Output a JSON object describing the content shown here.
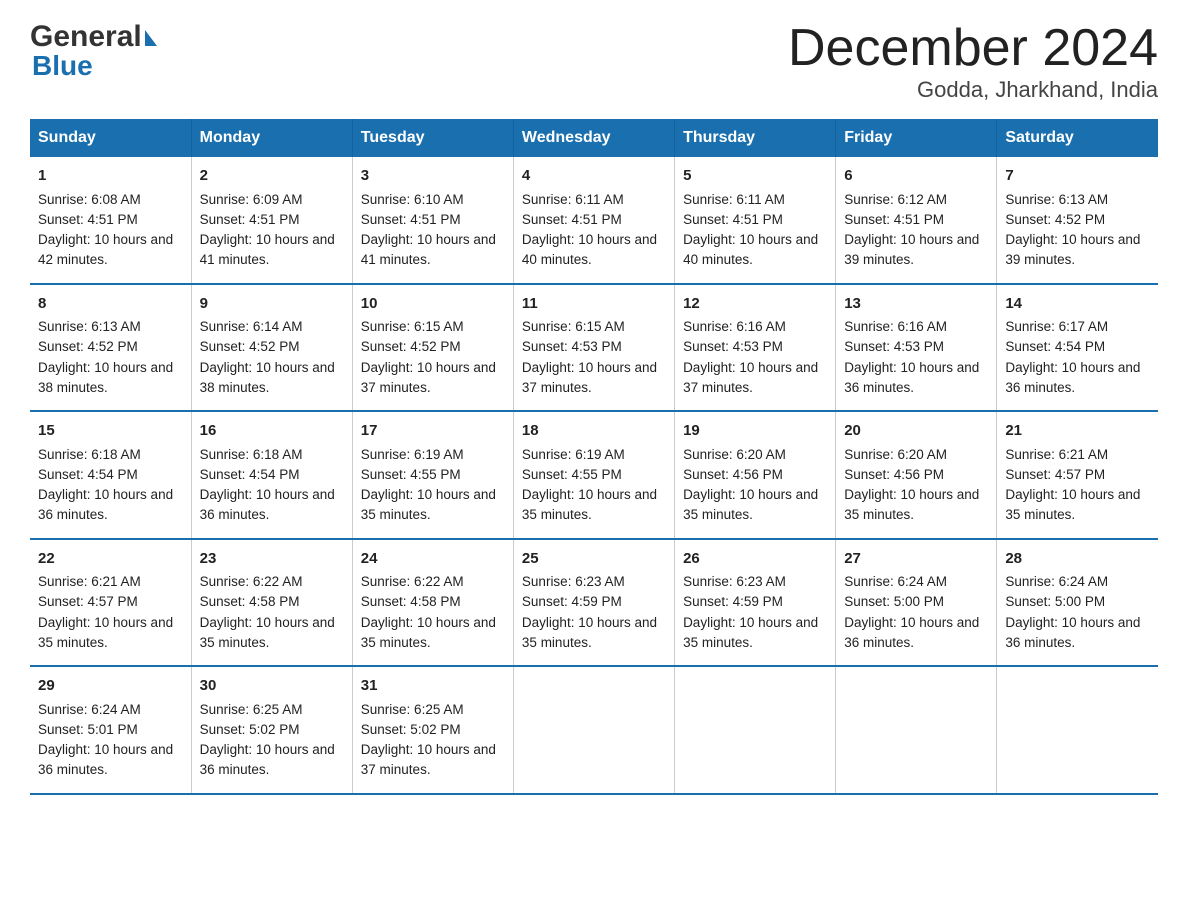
{
  "header": {
    "title": "December 2024",
    "subtitle": "Godda, Jharkhand, India",
    "logo_general": "General",
    "logo_blue": "Blue"
  },
  "days_of_week": [
    "Sunday",
    "Monday",
    "Tuesday",
    "Wednesday",
    "Thursday",
    "Friday",
    "Saturday"
  ],
  "weeks": [
    {
      "days": [
        {
          "num": "1",
          "sunrise": "6:08 AM",
          "sunset": "4:51 PM",
          "daylight": "10 hours and 42 minutes."
        },
        {
          "num": "2",
          "sunrise": "6:09 AM",
          "sunset": "4:51 PM",
          "daylight": "10 hours and 41 minutes."
        },
        {
          "num": "3",
          "sunrise": "6:10 AM",
          "sunset": "4:51 PM",
          "daylight": "10 hours and 41 minutes."
        },
        {
          "num": "4",
          "sunrise": "6:11 AM",
          "sunset": "4:51 PM",
          "daylight": "10 hours and 40 minutes."
        },
        {
          "num": "5",
          "sunrise": "6:11 AM",
          "sunset": "4:51 PM",
          "daylight": "10 hours and 40 minutes."
        },
        {
          "num": "6",
          "sunrise": "6:12 AM",
          "sunset": "4:51 PM",
          "daylight": "10 hours and 39 minutes."
        },
        {
          "num": "7",
          "sunrise": "6:13 AM",
          "sunset": "4:52 PM",
          "daylight": "10 hours and 39 minutes."
        }
      ]
    },
    {
      "days": [
        {
          "num": "8",
          "sunrise": "6:13 AM",
          "sunset": "4:52 PM",
          "daylight": "10 hours and 38 minutes."
        },
        {
          "num": "9",
          "sunrise": "6:14 AM",
          "sunset": "4:52 PM",
          "daylight": "10 hours and 38 minutes."
        },
        {
          "num": "10",
          "sunrise": "6:15 AM",
          "sunset": "4:52 PM",
          "daylight": "10 hours and 37 minutes."
        },
        {
          "num": "11",
          "sunrise": "6:15 AM",
          "sunset": "4:53 PM",
          "daylight": "10 hours and 37 minutes."
        },
        {
          "num": "12",
          "sunrise": "6:16 AM",
          "sunset": "4:53 PM",
          "daylight": "10 hours and 37 minutes."
        },
        {
          "num": "13",
          "sunrise": "6:16 AM",
          "sunset": "4:53 PM",
          "daylight": "10 hours and 36 minutes."
        },
        {
          "num": "14",
          "sunrise": "6:17 AM",
          "sunset": "4:54 PM",
          "daylight": "10 hours and 36 minutes."
        }
      ]
    },
    {
      "days": [
        {
          "num": "15",
          "sunrise": "6:18 AM",
          "sunset": "4:54 PM",
          "daylight": "10 hours and 36 minutes."
        },
        {
          "num": "16",
          "sunrise": "6:18 AM",
          "sunset": "4:54 PM",
          "daylight": "10 hours and 36 minutes."
        },
        {
          "num": "17",
          "sunrise": "6:19 AM",
          "sunset": "4:55 PM",
          "daylight": "10 hours and 35 minutes."
        },
        {
          "num": "18",
          "sunrise": "6:19 AM",
          "sunset": "4:55 PM",
          "daylight": "10 hours and 35 minutes."
        },
        {
          "num": "19",
          "sunrise": "6:20 AM",
          "sunset": "4:56 PM",
          "daylight": "10 hours and 35 minutes."
        },
        {
          "num": "20",
          "sunrise": "6:20 AM",
          "sunset": "4:56 PM",
          "daylight": "10 hours and 35 minutes."
        },
        {
          "num": "21",
          "sunrise": "6:21 AM",
          "sunset": "4:57 PM",
          "daylight": "10 hours and 35 minutes."
        }
      ]
    },
    {
      "days": [
        {
          "num": "22",
          "sunrise": "6:21 AM",
          "sunset": "4:57 PM",
          "daylight": "10 hours and 35 minutes."
        },
        {
          "num": "23",
          "sunrise": "6:22 AM",
          "sunset": "4:58 PM",
          "daylight": "10 hours and 35 minutes."
        },
        {
          "num": "24",
          "sunrise": "6:22 AM",
          "sunset": "4:58 PM",
          "daylight": "10 hours and 35 minutes."
        },
        {
          "num": "25",
          "sunrise": "6:23 AM",
          "sunset": "4:59 PM",
          "daylight": "10 hours and 35 minutes."
        },
        {
          "num": "26",
          "sunrise": "6:23 AM",
          "sunset": "4:59 PM",
          "daylight": "10 hours and 35 minutes."
        },
        {
          "num": "27",
          "sunrise": "6:24 AM",
          "sunset": "5:00 PM",
          "daylight": "10 hours and 36 minutes."
        },
        {
          "num": "28",
          "sunrise": "6:24 AM",
          "sunset": "5:00 PM",
          "daylight": "10 hours and 36 minutes."
        }
      ]
    },
    {
      "days": [
        {
          "num": "29",
          "sunrise": "6:24 AM",
          "sunset": "5:01 PM",
          "daylight": "10 hours and 36 minutes."
        },
        {
          "num": "30",
          "sunrise": "6:25 AM",
          "sunset": "5:02 PM",
          "daylight": "10 hours and 36 minutes."
        },
        {
          "num": "31",
          "sunrise": "6:25 AM",
          "sunset": "5:02 PM",
          "daylight": "10 hours and 37 minutes."
        },
        null,
        null,
        null,
        null
      ]
    }
  ],
  "label_sunrise": "Sunrise:",
  "label_sunset": "Sunset:",
  "label_daylight": "Daylight:"
}
